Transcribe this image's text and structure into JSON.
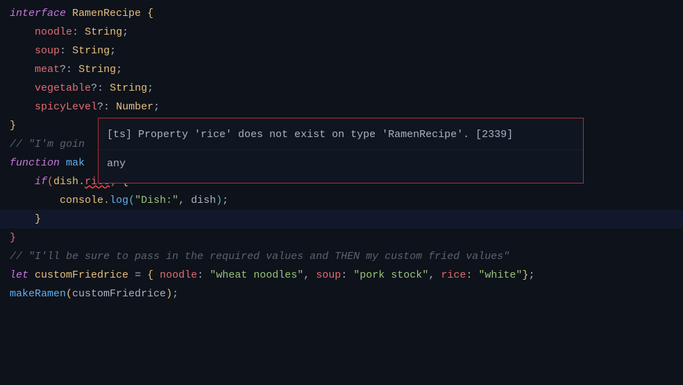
{
  "code": {
    "line1": {
      "kw": "interface",
      "name": "RamenRecipe",
      "brace": "{"
    },
    "line2": {
      "prop": "noodle",
      "colon": ":",
      "type": "String",
      "semi": ";"
    },
    "line3": {
      "prop": "soup",
      "colon": ":",
      "type": "String",
      "semi": ";"
    },
    "line4": {
      "prop": "meat",
      "opt": "?",
      "colon": ":",
      "type": "String",
      "semi": ";"
    },
    "line5": {
      "prop": "vegetable",
      "opt": "?",
      "colon": ":",
      "type": "String",
      "semi": ";"
    },
    "line6": {
      "prop": "spicyLevel",
      "opt": "?",
      "colon": ":",
      "type": "Number",
      "semi": ";"
    },
    "line7": {
      "brace": "}"
    },
    "line9": {
      "comment": "// \"I'm goin"
    },
    "line10": {
      "kw": "function",
      "name": "mak"
    },
    "line11": {
      "kw": "if",
      "paren1": "(",
      "obj": "dish",
      "dot": ".",
      "prop": "rice",
      "paren2": ")",
      "brace": "{"
    },
    "line12": {
      "obj": "console",
      "dot": ".",
      "method": "log",
      "paren1": "(",
      "str": "\"Dish:\"",
      "comma": ",",
      "arg": "dish",
      "paren2": ")",
      "semi": ";"
    },
    "line13": {
      "brace": "}"
    },
    "line14": {
      "brace": "}"
    },
    "line16": {
      "comment": "// \"I'll be sure to pass in the required values and THEN my custom fried values\""
    },
    "line17": {
      "kw": "let",
      "name": "customFriedrice",
      "eq": "=",
      "brace1": "{",
      "p1": "noodle",
      "c1": ":",
      "v1": "\"wheat noodles\"",
      "cm1": ",",
      "p2": "soup",
      "c2": ":",
      "v2": "\"pork stock\"",
      "cm2": ",",
      "p3": "rice",
      "c3": ":",
      "v3": "\"white\"",
      "brace2": "}",
      "semi": ";"
    },
    "line19": {
      "func": "makeRamen",
      "paren1": "(",
      "arg": "customFriedrice",
      "paren2": ")",
      "semi": ";"
    }
  },
  "tooltip": {
    "error_prefix": "[ts] Property ",
    "error_prop": "'rice'",
    "error_mid": " does not exist on type ",
    "error_type": "'RamenRecipe'",
    "error_suffix": ". [2339]",
    "typeinfo": "any"
  }
}
